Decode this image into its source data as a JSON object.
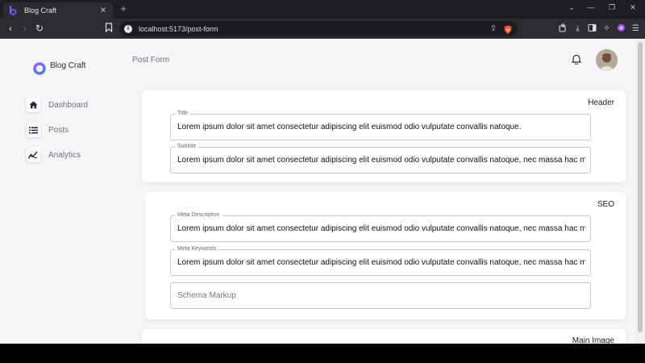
{
  "browser": {
    "tab_title": "Blog Craft",
    "tab_close": "✕",
    "new_tab": "+",
    "url": "localhost:5173/post-form",
    "window_controls": {
      "dropdown": "⌄",
      "minimize": "—",
      "restore": "❐",
      "close": "✕"
    }
  },
  "sidebar": {
    "brand": "Blog Craft",
    "items": [
      {
        "label": "Dashboard",
        "icon": "home-icon"
      },
      {
        "label": "Posts",
        "icon": "list-icon"
      },
      {
        "label": "Analytics",
        "icon": "chart-icon"
      }
    ]
  },
  "header": {
    "title": "Post Form"
  },
  "sections": {
    "header": {
      "title": "Header",
      "title_field": {
        "label": "Title",
        "value": "Lorem ipsum dolor sit amet consectetur adipiscing elit euismod odio vulputate convallis natoque."
      },
      "subtitle_field": {
        "label": "Subtitle",
        "value": "Lorem ipsum dolor sit amet consectetur adipiscing elit euismod odio vulputate convallis natoque, nec massa hac mauris"
      }
    },
    "seo": {
      "title": "SEO",
      "meta_description": {
        "label": "Meta Description",
        "value": "Lorem ipsum dolor sit amet consectetur adipiscing elit euismod odio vulputate convallis natoque, nec massa hac mauris"
      },
      "meta_keywords": {
        "label": "Meta Keywords",
        "value": "Lorem ipsum dolor sit amet consectetur adipiscing elit euismod odio vulputate convallis natoque, nec massa hac mauris"
      },
      "schema_markup": {
        "placeholder": "Schema Markup"
      }
    },
    "main_image": {
      "title": "Main Image"
    }
  }
}
